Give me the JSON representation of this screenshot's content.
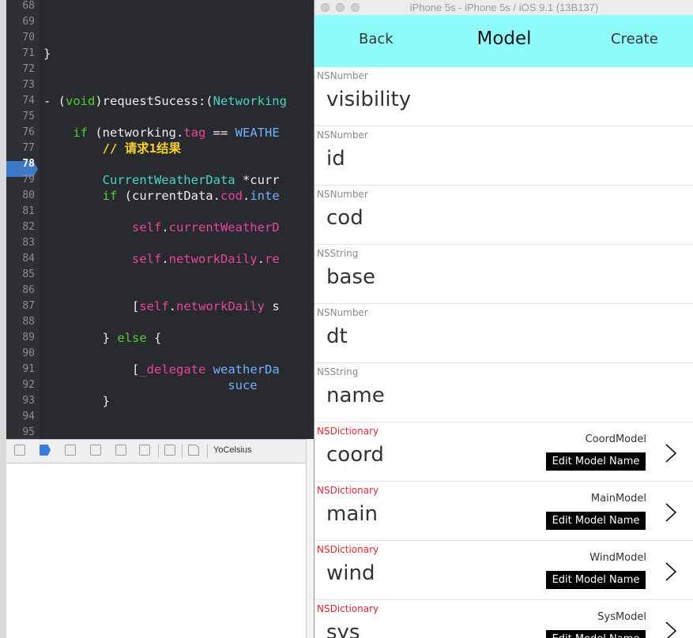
{
  "xcode": {
    "lines": [
      {
        "num": "68",
        "segments": []
      },
      {
        "num": "69",
        "segments": []
      },
      {
        "num": "70",
        "segments": []
      },
      {
        "num": "71",
        "segments": [
          {
            "t": "plain",
            "text": "}"
          }
        ]
      },
      {
        "num": "72",
        "segments": []
      },
      {
        "num": "73",
        "segments": []
      },
      {
        "num": "74",
        "segments": [
          {
            "t": "plain",
            "text": "- ("
          },
          {
            "t": "kw",
            "text": "void"
          },
          {
            "t": "plain",
            "text": ")requestSucess:("
          },
          {
            "t": "cls",
            "text": "Networking"
          }
        ]
      },
      {
        "num": "75",
        "segments": []
      },
      {
        "num": "76",
        "segments": [
          {
            "t": "plain",
            "text": "    "
          },
          {
            "t": "kw",
            "text": "if"
          },
          {
            "t": "plain",
            "text": " (networking."
          },
          {
            "t": "prop",
            "text": "tag"
          },
          {
            "t": "plain",
            "text": " == "
          },
          {
            "t": "cst",
            "text": "WEATHE"
          }
        ]
      },
      {
        "num": "77",
        "segments": [
          {
            "t": "plain",
            "text": "        "
          },
          {
            "t": "cm",
            "text": "// 请求1结果"
          }
        ]
      },
      {
        "num": "78",
        "segments": [],
        "current": true
      },
      {
        "num": "79",
        "segments": [
          {
            "t": "plain",
            "text": "        "
          },
          {
            "t": "cls",
            "text": "CurrentWeatherData"
          },
          {
            "t": "plain",
            "text": " *curr"
          }
        ]
      },
      {
        "num": "80",
        "segments": [
          {
            "t": "plain",
            "text": "        "
          },
          {
            "t": "kw",
            "text": "if"
          },
          {
            "t": "plain",
            "text": " (currentData."
          },
          {
            "t": "prop",
            "text": "cod"
          },
          {
            "t": "plain",
            "text": "."
          },
          {
            "t": "cst",
            "text": "inte"
          }
        ]
      },
      {
        "num": "81",
        "segments": []
      },
      {
        "num": "82",
        "segments": [
          {
            "t": "plain",
            "text": "            "
          },
          {
            "t": "prop",
            "text": "self"
          },
          {
            "t": "plain",
            "text": "."
          },
          {
            "t": "prop",
            "text": "currentWeatherD"
          }
        ]
      },
      {
        "num": "83",
        "segments": []
      },
      {
        "num": "84",
        "segments": [
          {
            "t": "plain",
            "text": "            "
          },
          {
            "t": "prop",
            "text": "self"
          },
          {
            "t": "plain",
            "text": "."
          },
          {
            "t": "prop",
            "text": "networkDaily"
          },
          {
            "t": "plain",
            "text": "."
          },
          {
            "t": "prop",
            "text": "re"
          }
        ]
      },
      {
        "num": "85",
        "segments": []
      },
      {
        "num": "86",
        "segments": []
      },
      {
        "num": "87",
        "segments": [
          {
            "t": "plain",
            "text": "            ["
          },
          {
            "t": "prop",
            "text": "self"
          },
          {
            "t": "plain",
            "text": "."
          },
          {
            "t": "prop",
            "text": "networkDaily"
          },
          {
            "t": "plain",
            "text": " s"
          }
        ]
      },
      {
        "num": "88",
        "segments": []
      },
      {
        "num": "89",
        "segments": [
          {
            "t": "plain",
            "text": "        } "
          },
          {
            "t": "kw",
            "text": "else"
          },
          {
            "t": "plain",
            "text": " {"
          }
        ]
      },
      {
        "num": "90",
        "segments": []
      },
      {
        "num": "91",
        "segments": [
          {
            "t": "plain",
            "text": "            ["
          },
          {
            "t": "prop",
            "text": "_delegate"
          },
          {
            "t": "plain",
            "text": " "
          },
          {
            "t": "cst",
            "text": "weatherDa"
          }
        ]
      },
      {
        "num": "92",
        "segments": [
          {
            "t": "plain",
            "text": "                         "
          },
          {
            "t": "cst",
            "text": "suce"
          }
        ]
      },
      {
        "num": "93",
        "segments": [
          {
            "t": "plain",
            "text": "        }"
          }
        ]
      },
      {
        "num": "94",
        "segments": []
      },
      {
        "num": "95",
        "segments": []
      }
    ]
  },
  "debug_bar": {
    "target_label": "YoCelsius"
  },
  "colors": {
    "nav_bar": "#8ffcfc",
    "dictionary_type": "#e0262f",
    "breakpoint": "#3f78c9"
  },
  "simulator": {
    "window_title": "iPhone 5s - iPhone 5s / iOS 9.1 (13B137)",
    "nav": {
      "back_label": "Back",
      "title": "Model",
      "create_label": "Create"
    },
    "rows": [
      {
        "type": "NSNumber",
        "key": "visibility"
      },
      {
        "type": "NSNumber",
        "key": "id"
      },
      {
        "type": "NSNumber",
        "key": "cod"
      },
      {
        "type": "NSString",
        "key": "base"
      },
      {
        "type": "NSNumber",
        "key": "dt"
      },
      {
        "type": "NSString",
        "key": "name"
      },
      {
        "type": "NSDictionary",
        "key": "coord",
        "model": "CoordModel",
        "button": "Edit Model Name"
      },
      {
        "type": "NSDictionary",
        "key": "main",
        "model": "MainModel",
        "button": "Edit Model Name"
      },
      {
        "type": "NSDictionary",
        "key": "wind",
        "model": "WindModel",
        "button": "Edit Model Name"
      },
      {
        "type": "NSDictionary",
        "key": "sys",
        "model": "SysModel",
        "button": "Edit Model Name"
      }
    ]
  }
}
